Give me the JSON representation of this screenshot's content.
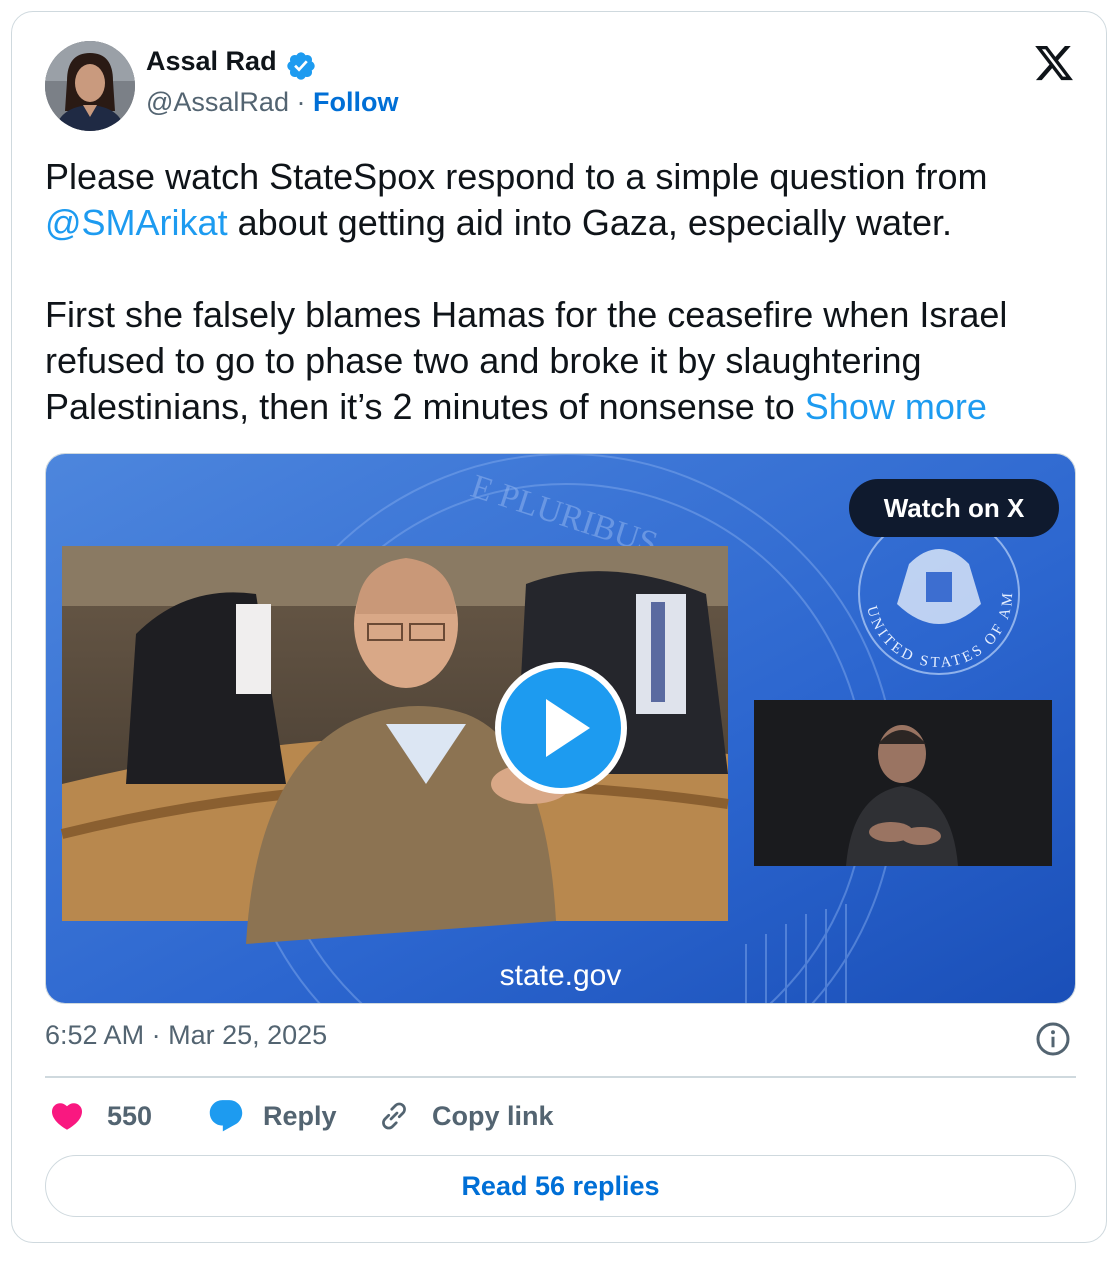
{
  "author": {
    "name": "Assal Rad",
    "handle": "@AssalRad",
    "separator": "·",
    "follow_label": "Follow",
    "verified_icon": "verified-badge-icon"
  },
  "brand": {
    "logo": "x-logo-icon"
  },
  "tweet": {
    "para1_before": "Please watch StateSpox respond to a simple question from ",
    "mention": "@SMArikat",
    "para1_after": " about getting aid into Gaza, especially water.",
    "para2": "First she falsely blames Hamas for the ceasefire when Israel refused to go to phase two and broke it by slaughtering Palestinians, then it’s 2 minutes of nonsense to ",
    "show_more": "Show more"
  },
  "media": {
    "watch_label": "Watch on X",
    "caption": "state.gov",
    "seal_text_top": "E PLURIBUS",
    "seal_text_ring": "UNITED STATES OF AMERICA"
  },
  "meta": {
    "time": "6:52 AM",
    "separator": "·",
    "date": "Mar 25, 2025"
  },
  "actions": {
    "likes": "550",
    "reply_label": "Reply",
    "copy_label": "Copy link",
    "read_replies_label": "Read 56 replies"
  },
  "colors": {
    "accent": "#1d9bf0",
    "link_dark": "#006fd6",
    "like": "#f91880",
    "secondary_text": "#536471",
    "border": "#cfd9de"
  }
}
